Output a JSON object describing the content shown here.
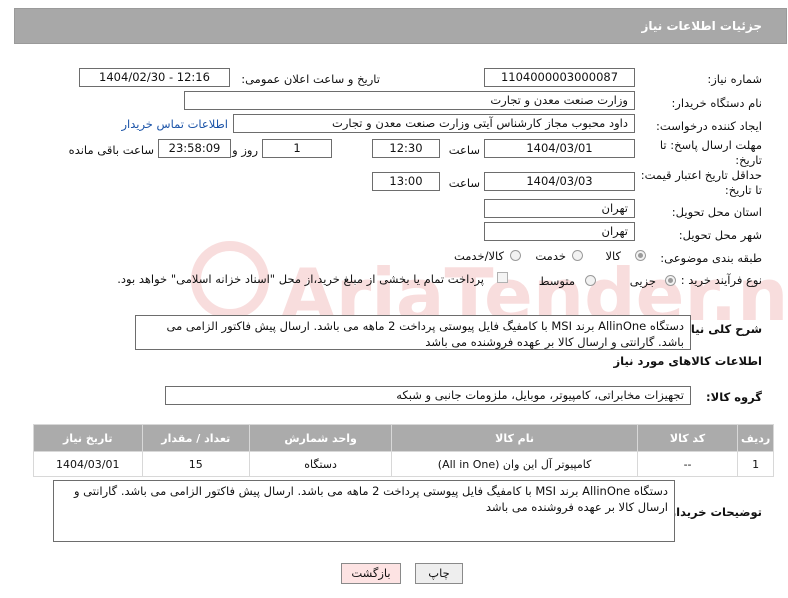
{
  "panel": {
    "title": "جزئیات اطلاعات نیاز"
  },
  "labels": {
    "need_number": "شماره نیاز:",
    "announce_datetime": "تاریخ و ساعت اعلان عمومی:",
    "buyer_org": "نام دستگاه خریدار:",
    "requester": "ایجاد کننده درخواست:",
    "reply_deadline_1": "مهلت ارسال پاسخ: تا",
    "reply_deadline_2": "تاریخ:",
    "price_validity_1": "حداقل تاریخ اعتبار قیمت:",
    "price_validity_2": "تا تاریخ:",
    "time": "ساعت",
    "day_and": "روز و",
    "remaining": "ساعت باقی مانده",
    "province": "استان محل تحویل:",
    "city": "شهر محل تحویل:",
    "category": "طبقه بندی موضوعی:",
    "process": "نوع فرآیند خرید :",
    "general_desc": "شرح کلی نیاز:",
    "goods_info": "اطلاعات کالاهای مورد نیاز",
    "goods_group": "گروه کالا:",
    "buyer_notes": "توضیحات خریدار:"
  },
  "values": {
    "need_number": "1104000003000087",
    "announce_datetime": "1404/02/30 - 12:16",
    "buyer_org": "وزارت صنعت معدن و تجارت",
    "requester": "داود محبوب مجاز کارشناس آیتی وزارت صنعت معدن و تجارت",
    "contact_link": "اطلاعات تماس خریدار",
    "reply_date": "1404/03/01",
    "reply_time": "12:30",
    "days": "1",
    "remaining_time": "23:58:09",
    "validity_date": "1404/03/03",
    "validity_time": "13:00",
    "province": "تهران",
    "city": "تهران",
    "general_desc": "دستگاه AllinOne برند MSI با کامفیگ فایل پیوستی پرداخت 2 ماهه می باشد. ارسال پیش فاکتور الزامی می باشد. گارانتی و ارسال کالا بر عهده فروشنده می باشد",
    "goods_group": "تجهیزات مخابراتی، کامپیوتر، موبایل، ملزومات جانبی و شبکه",
    "buyer_notes": "دستگاه AllinOne برند MSI با کامفیگ فایل پیوستی پرداخت 2 ماهه می باشد. ارسال پیش فاکتور الزامی می باشد. گارانتی و ارسال کالا بر عهده فروشنده می باشد"
  },
  "category_options": [
    {
      "label": "کالا",
      "selected": true
    },
    {
      "label": "خدمت",
      "selected": false
    },
    {
      "label": "کالا/خدمت",
      "selected": false
    }
  ],
  "process_options": [
    {
      "label": "جزیی",
      "selected": true
    },
    {
      "label": "متوسط",
      "selected": false
    }
  ],
  "process_note": "پرداخت تمام یا بخشی از مبلغ خرید،از محل \"اسناد خزانه اسلامی\" خواهد بود.",
  "table": {
    "headers": [
      "ردیف",
      "کد کالا",
      "نام کالا",
      "واحد شمارش",
      "تعداد / مقدار",
      "تاریخ نیاز"
    ],
    "rows": [
      [
        "1",
        "--",
        "کامپیوتر آل این وان (All in One)",
        "دستگاه",
        "15",
        "1404/03/01"
      ]
    ]
  },
  "buttons": {
    "print": "چاپ",
    "back": "بازگشت"
  },
  "watermark": {
    "text": "AriaTender.neT"
  },
  "colors": {
    "header_bg": "#a8a8a8",
    "link": "#1c54a8",
    "back_button_bg": "#fde3e3",
    "print_button_bg": "#eeeeee"
  }
}
